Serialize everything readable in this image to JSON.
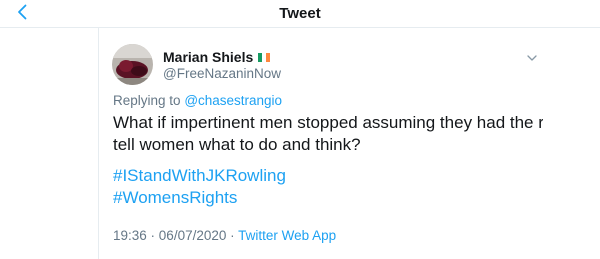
{
  "header": {
    "back_icon": "chevron-left-icon",
    "title": "Tweet"
  },
  "tweet": {
    "author": {
      "name": "Marian Shiels",
      "flag_icon": "ireland-flag-icon",
      "handle": "@FreeNazaninNow",
      "avatar_icon": "avatar-photo"
    },
    "caret_icon": "chevron-down-icon",
    "reply": {
      "prefix": "Replying to",
      "mention": "@chasestrangio"
    },
    "text_lines": [
      "What if impertinent men stopped assuming they had the right to",
      "tell women what to do and think?"
    ],
    "hashtags": [
      "#IStandWithJKRowling",
      "#WomensRights"
    ],
    "meta": {
      "time": "19:36",
      "separator": " · ",
      "date": "06/07/2020",
      "source_separator": " · ",
      "source": "Twitter Web App"
    }
  },
  "colors": {
    "accent": "#1da1f2",
    "text": "#14171a",
    "secondary": "#657786",
    "border": "#e6ecf0"
  }
}
